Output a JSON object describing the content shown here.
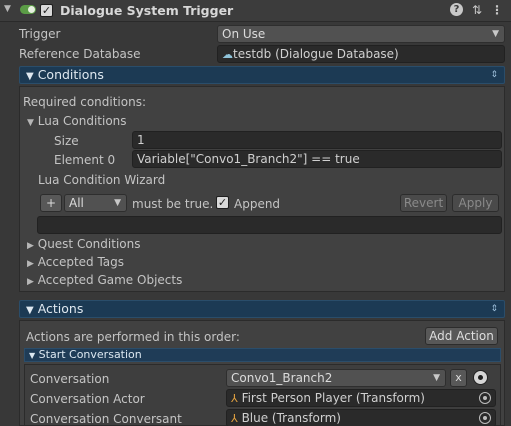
{
  "header": {
    "title": "Dialogue System Trigger",
    "enabled_checked": true,
    "help_icon": "help-icon",
    "settings_icon": "preset-icon",
    "menu_icon": "kebab-menu-icon"
  },
  "trigger": {
    "label": "Trigger",
    "value": "On Use"
  },
  "reference_database": {
    "label": "Reference Database",
    "value": "testdb (Dialogue Database)"
  },
  "conditions": {
    "title": "Conditions",
    "required_label": "Required conditions:",
    "lua_conditions": {
      "title": "Lua Conditions",
      "size_label": "Size",
      "size_value": "1",
      "element0_label": "Element 0",
      "element0_value": "Variable[\"Convo1_Branch2\"] == true"
    },
    "wizard": {
      "title": "Lua Condition Wizard",
      "add_label": "+",
      "mode_value": "All",
      "must_be_true": "must be true.",
      "append_label": "Append",
      "append_checked": true,
      "revert_label": "Revert",
      "apply_label": "Apply"
    },
    "quest_conditions": "Quest Conditions",
    "accepted_tags": "Accepted Tags",
    "accepted_game_objects": "Accepted Game Objects"
  },
  "actions": {
    "title": "Actions",
    "order_label": "Actions are performed in this order:",
    "add_action_label": "Add Action",
    "start_conversation": {
      "title": "Start Conversation",
      "conversation_label": "Conversation",
      "conversation_value": "Convo1_Branch2",
      "clear_label": "x",
      "actor_label": "Conversation Actor",
      "actor_value": "First Person Player (Transform)",
      "conversant_label": "Conversation Conversant",
      "conversant_value": "Blue (Transform)"
    }
  },
  "colors": {
    "background": "#383838",
    "foldout_bar": "#1c3a54",
    "toggle_green": "#5b9c46",
    "field_bg": "#2a2a2a"
  }
}
